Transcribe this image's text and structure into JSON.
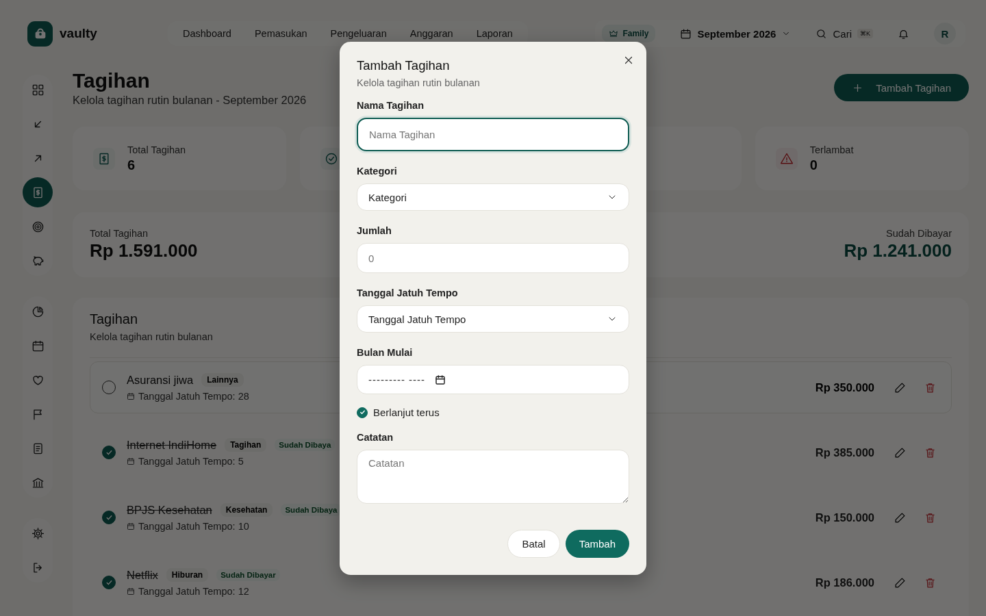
{
  "brand": {
    "name": "vaulty"
  },
  "nav": [
    "Dashboard",
    "Pemasukan",
    "Pengeluaran",
    "Anggaran",
    "Laporan"
  ],
  "plan_badge": "Family",
  "month_picker": "September 2026",
  "search": {
    "placeholder": "Cari",
    "shortcut": "⌘K"
  },
  "avatar": "R",
  "sidebar": [
    [
      {
        "selected": false
      },
      {
        "selected": false
      },
      {
        "selected": false
      },
      {
        "selected": true
      },
      {
        "selected": false
      },
      {
        "selected": false
      }
    ],
    [
      {
        "selected": false
      },
      {
        "selected": false
      },
      {
        "selected": false
      },
      {
        "selected": false
      },
      {
        "selected": false
      },
      {
        "selected": false
      }
    ],
    [
      {
        "selected": false
      },
      {
        "selected": false
      }
    ]
  ],
  "page": {
    "title": "Tagihan",
    "subtitle": "Kelola tagihan rutin bulanan - September 2026",
    "add_button": "Tambah Tagihan"
  },
  "stats": [
    {
      "kind": "bills",
      "label": "Total Tagihan",
      "value": "6"
    },
    {
      "kind": "paid"
    },
    {
      "kind": "blank"
    },
    {
      "kind": "late",
      "label": "Terlambat",
      "value": "0"
    }
  ],
  "summary": [
    {
      "kind": "total",
      "label": "Total Tagihan",
      "value": "Rp 1.591.000"
    },
    {
      "kind": "paid",
      "label": "Sudah Dibayar",
      "value": "Rp 1.241.000"
    }
  ],
  "bill_list": {
    "title": "Tagihan",
    "subtitle": "Kelola tagihan rutin bulanan",
    "rows": [
      {
        "name": "Asuransi jiwa",
        "category": "Lainnya",
        "paid": false,
        "due": "Tanggal Jatuh Tempo: 28",
        "amount": "Rp 350.000"
      },
      {
        "name": "Internet IndiHome",
        "category": "Tagihan",
        "paid": true,
        "status": "Sudah Dibaya",
        "due": "Tanggal Jatuh Tempo: 5",
        "amount": "Rp 385.000"
      },
      {
        "name": "BPJS Kesehatan",
        "category": "Kesehatan",
        "paid": true,
        "status": "Sudah Dibaya",
        "due": "Tanggal Jatuh Tempo: 10",
        "amount": "Rp 150.000"
      },
      {
        "name": "Netflix",
        "category": "Hiburan",
        "paid": true,
        "status": "Sudah Dibayar",
        "due": "Tanggal Jatuh Tempo: 12",
        "amount": "Rp 186.000"
      }
    ]
  },
  "dialog": {
    "title": "Tambah Tagihan",
    "subtitle": "Kelola tagihan rutin bulanan",
    "fields": [
      {
        "kind": "text",
        "label": "Nama Tagihan",
        "placeholder": "Nama Tagihan",
        "focused": true
      },
      {
        "kind": "select",
        "label": "Kategori",
        "value": "Kategori"
      },
      {
        "kind": "text",
        "label": "Jumlah",
        "placeholder": "0",
        "focused": false
      },
      {
        "kind": "select",
        "label": "Tanggal Jatuh Tempo",
        "value": "Tanggal Jatuh Tempo"
      },
      {
        "kind": "month",
        "label": "Bulan Mulai",
        "value": "--------- ----"
      },
      {
        "kind": "checkbox",
        "label": "Berlanjut terus",
        "checked": true
      },
      {
        "kind": "textarea",
        "label": "Catatan",
        "placeholder": "Catatan"
      }
    ],
    "buttons": [
      {
        "kind": "secondary",
        "label": "Batal"
      },
      {
        "kind": "primary",
        "label": "Tambah"
      }
    ]
  }
}
